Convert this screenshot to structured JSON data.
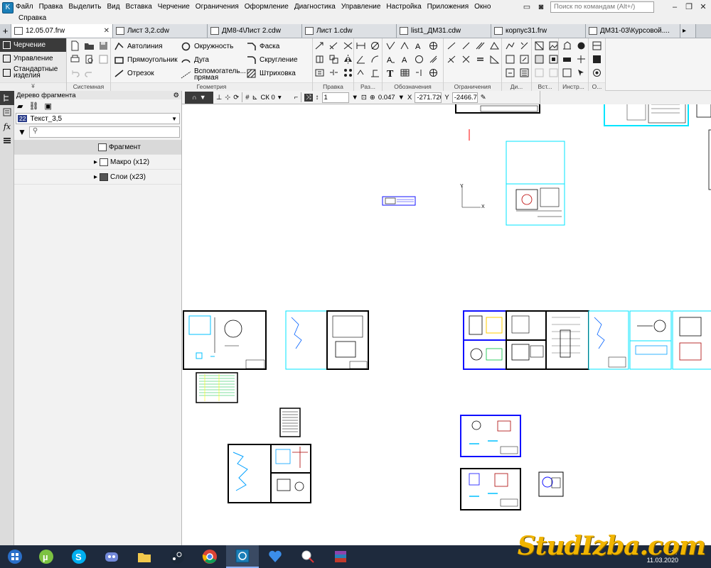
{
  "menu": {
    "row1": [
      "Файл",
      "Правка",
      "Выделить",
      "Вид",
      "Вставка",
      "Черчение",
      "Ограничения",
      "Оформление",
      "Диагностика",
      "Управление",
      "Настройка",
      "Приложения",
      "Окно"
    ],
    "row2": [
      "Справка"
    ],
    "search_placeholder": "Поиск по командам (Alt+/)"
  },
  "tabs": [
    {
      "label": "12.05.07.frw",
      "active": true
    },
    {
      "label": "Лист 3,2.cdw",
      "active": false
    },
    {
      "label": "ДМ8-4\\Лист 2.cdw",
      "active": false
    },
    {
      "label": "Лист 1.cdw",
      "active": false
    },
    {
      "label": "list1_ДМ31.cdw",
      "active": false
    },
    {
      "label": "корпус31.frw",
      "active": false
    },
    {
      "label": "ДМ31-03\\Курсовой....",
      "active": false
    }
  ],
  "modes": {
    "items": [
      "Черчение",
      "Управление",
      "Стандартные изделия"
    ],
    "expand_glyph": "¥"
  },
  "ribbon": {
    "groups": {
      "system": "Системная",
      "geometry": "Геометрия",
      "edit": "Правка",
      "sizes": "Раз...",
      "notation": "Обозначения",
      "constraints": "Ограничения",
      "di": "Ди...",
      "vst": "Вст...",
      "instr": "Инстр...",
      "o": "О..."
    },
    "geometry_buttons": {
      "autoline": "Автолиния",
      "rectangle": "Прямоугольник",
      "segment": "Отрезок",
      "circle": "Окружность",
      "arc": "Дуга",
      "aux_line": "Вспомогатель... прямая",
      "chamfer": "Фаска",
      "fillet": "Скругление",
      "hatch": "Штриховка"
    }
  },
  "tree": {
    "title": "Дерево фрагмента",
    "style_number": "22",
    "style_name": "Текст_3,5",
    "rows": [
      {
        "label": "Фрагмент"
      },
      {
        "label": "Макро (x12)"
      },
      {
        "label": "Слои (x23)"
      }
    ]
  },
  "drawtools": {
    "cs": "СК 0",
    "step": "1",
    "zoom": "0.047",
    "x_label": "X",
    "x_value": "-271.720",
    "y_label": "Y",
    "y_value": "-2466.70"
  },
  "canvas": {
    "axis_y": "Y",
    "axis_x": "X"
  },
  "taskbar": {
    "time": "2:27",
    "date": "11.03.2020"
  },
  "watermark": "StudIzba.com",
  "colors": {
    "accent": "#1b7fb8",
    "drawing_cyan": "#00e5ff",
    "drawing_blue": "#1010ff",
    "watermark": "#f1b500"
  }
}
